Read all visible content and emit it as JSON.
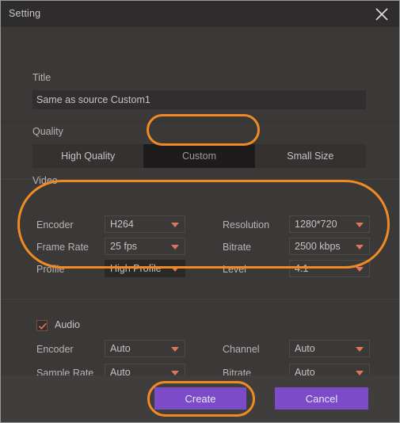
{
  "window": {
    "title": "Setting",
    "close_icon": "close-icon"
  },
  "title_section": {
    "label": "Title",
    "value": "Same as source Custom1",
    "placeholder": "Title"
  },
  "quality_section": {
    "label": "Quality",
    "tabs": [
      {
        "label": "High Quality",
        "active": false
      },
      {
        "label": "Custom",
        "active": true
      },
      {
        "label": "Small Size",
        "active": false
      }
    ]
  },
  "video_section": {
    "label": "Video",
    "fields": [
      {
        "label": "Encoder",
        "value": "H264"
      },
      {
        "label": "Frame Rate",
        "value": "25 fps"
      },
      {
        "label": "Profile",
        "value": "High Profile"
      },
      {
        "label": "Resolution",
        "value": "1280*720"
      },
      {
        "label": "Bitrate",
        "value": "2500 kbps"
      },
      {
        "label": "Level",
        "value": "4.1"
      }
    ]
  },
  "audio_section": {
    "label": "Audio",
    "checked": true,
    "check_icon": "check-icon",
    "fields": [
      {
        "label": "Encoder",
        "value": "Auto"
      },
      {
        "label": "Sample Rate",
        "value": "Auto"
      },
      {
        "label": "Channel",
        "value": "Auto"
      },
      {
        "label": "Bitrate",
        "value": "Auto"
      }
    ]
  },
  "footer": {
    "create_label": "Create",
    "cancel_label": "Cancel"
  },
  "colors": {
    "accent_purple": "#7b4bc9",
    "annotation_orange": "#f08b24",
    "dropdown_arrow": "#e2735a",
    "window_bg": "#3b3838",
    "titlebar_bg": "#2e2c2c"
  }
}
